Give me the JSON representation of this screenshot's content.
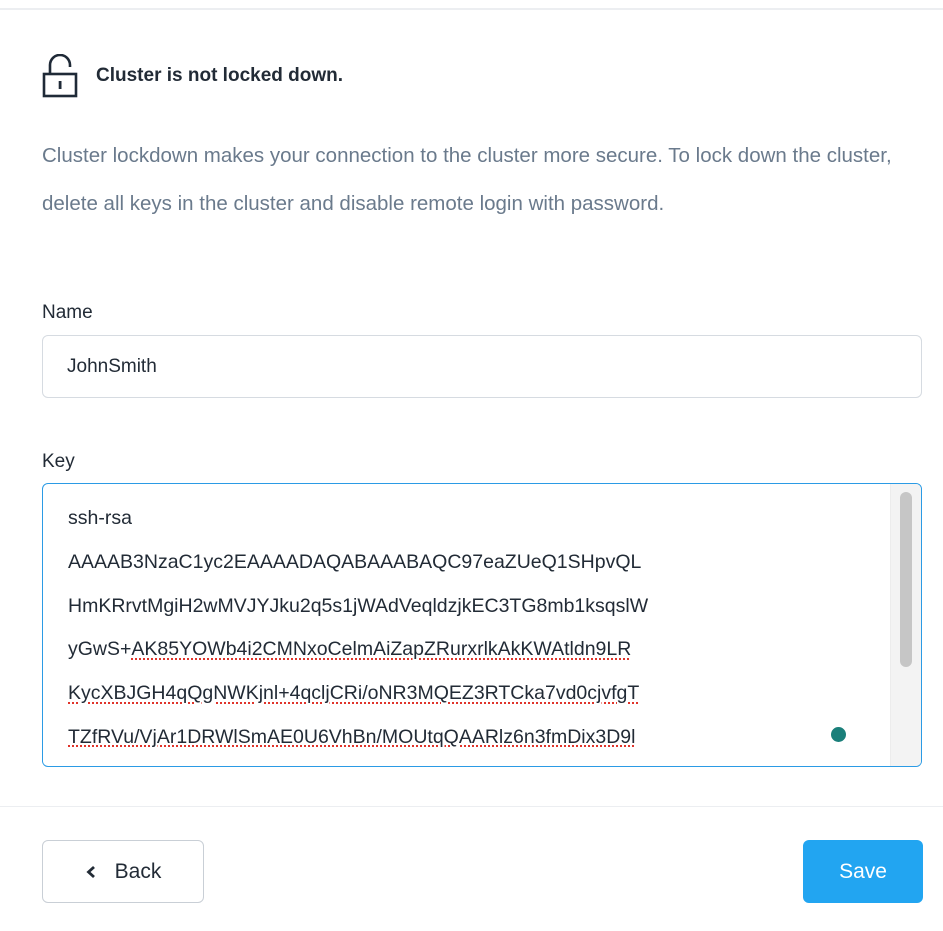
{
  "status": {
    "icon": "unlocked-padlock-icon",
    "text": "Cluster is not locked down."
  },
  "description": "Cluster lockdown makes your connection to the cluster more secure. To lock down the cluster, delete all keys in the cluster and disable remote login with password.",
  "form": {
    "name_label": "Name",
    "name_value": "JohnSmith",
    "key_label": "Key",
    "key_lines": [
      "ssh-rsa",
      "AAAAB3NzaC1yc2EAAAADAQABAAABAQC97eaZUeQ1SHpvQL",
      "HmKRrvtMgiH2wMVJYJku2q5s1jWAdVeqldzjkEC3TG8mb1ksqslW",
      "yGwS+",
      "AK85YOWb4i2CMNxoCelmAiZapZRurxrlkAkKWAtldn9LR",
      "KycXBJGH4qQgNWKjnl+4qcljCRi/oNR3MQEZ3RTCka7vd0cjvfgT",
      "TZfRVu/VjAr1DRWlSmAE0U6VhBn/MOUtqQAARlz6n3fmDix3D9l"
    ]
  },
  "footer": {
    "back_label": "Back",
    "save_label": "Save"
  },
  "colors": {
    "accent": "#22a5f1",
    "focus_border": "#2b9be5",
    "description_text": "#6a7a8c"
  }
}
